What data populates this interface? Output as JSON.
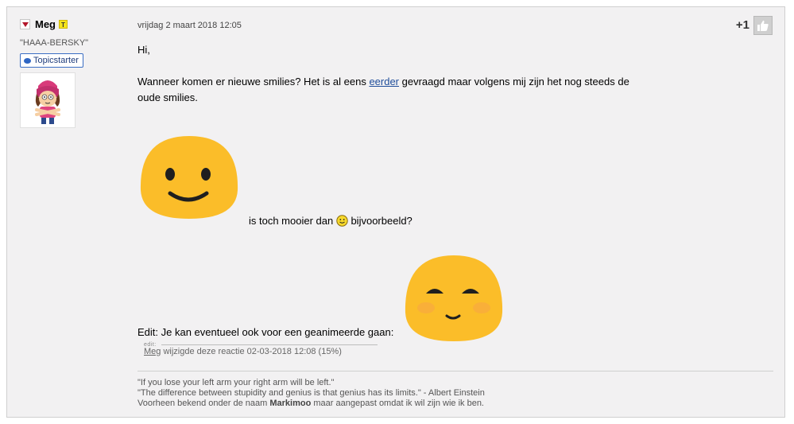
{
  "author": {
    "name": "Meg",
    "badge_letter": "T",
    "custom_title": "\"HAAA-BERSKY\"",
    "topicstarter_label": "Topicstarter"
  },
  "post": {
    "timestamp": "vrijdag 2 maart 2018 12:05",
    "plus_count": "+1",
    "greeting": "Hi,",
    "para_part1": "Wanneer komen er nieuwe smilies? Het is al eens ",
    "para_link": "eerder",
    "para_part2": " gevraagd maar volgens mij zijn het nog steeds de",
    "para_line2": "oude smilies.",
    "compare_before": "is toch mooier dan ",
    "compare_after": " bijvoorbeeld?",
    "edit_line": "Edit: Je kan eventueel ook voor een geanimeerde gaan:"
  },
  "edit_info": {
    "label": "edit:",
    "user": "Meg",
    "text": " wijzigde deze reactie 02-03-2018 12:08 (15%)"
  },
  "signature": {
    "line1": "\"If you lose your left arm your right arm will be left.\"",
    "line2": "\"The difference between stupidity and genius is that genius has its limits.\" - Albert Einstein",
    "line3_before": "Voorheen bekend onder de naam ",
    "line3_bold": "Markimoo",
    "line3_after": " maar aangepast omdat ik wil zijn wie ik ben."
  },
  "colors": {
    "emoji_yellow": "#fbbd29",
    "link": "#1f4d9a",
    "topicstarter_border": "#3b6ec3",
    "background": "#f2f1f2"
  },
  "icons": [
    "collapse-arrow-icon",
    "chat-bubble-icon",
    "thumbs-up-icon",
    "smiley-icon"
  ]
}
